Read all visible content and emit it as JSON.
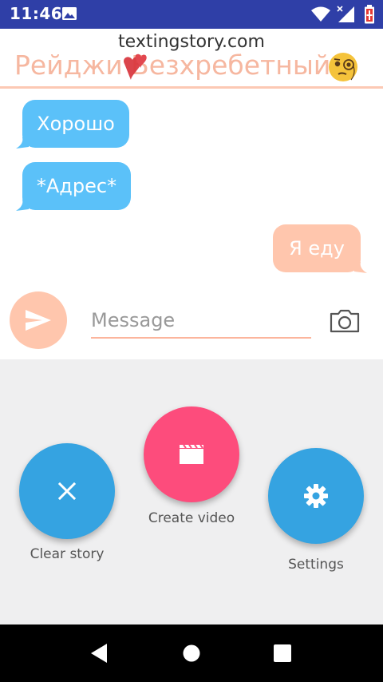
{
  "status_bar": {
    "time": "11:46",
    "background": "#2f3fa7",
    "icons": [
      "image-icon",
      "wifi-icon",
      "signal-icon",
      "battery-icon"
    ]
  },
  "header": {
    "watermark": "textingstory.com",
    "contact_name": "Рейджи Безхребетный",
    "name_color": "#f6b7a0",
    "icons": [
      "heart-icon",
      "monocle-emoji-icon"
    ]
  },
  "messages": [
    {
      "text": "Хорошо",
      "direction": "incoming"
    },
    {
      "text": "*Адрес*",
      "direction": "incoming"
    },
    {
      "text": "Я еду",
      "direction": "outgoing"
    }
  ],
  "bubble_colors": {
    "incoming": "#5bc1f9",
    "outgoing": "#ffc6ad"
  },
  "composer": {
    "placeholder": "Message",
    "send_icon": "send-icon",
    "camera_icon": "camera-icon"
  },
  "actions": {
    "clear_story": {
      "label": "Clear story",
      "icon": "close-icon",
      "color": "#35a3e1"
    },
    "create_video": {
      "label": "Create video",
      "icon": "clapperboard-icon",
      "color": "#fd4c7c"
    },
    "settings": {
      "label": "Settings",
      "icon": "gear-icon",
      "color": "#35a3e1"
    }
  },
  "nav_bar": {
    "icons": [
      "back-icon",
      "home-icon",
      "recents-icon"
    ]
  }
}
